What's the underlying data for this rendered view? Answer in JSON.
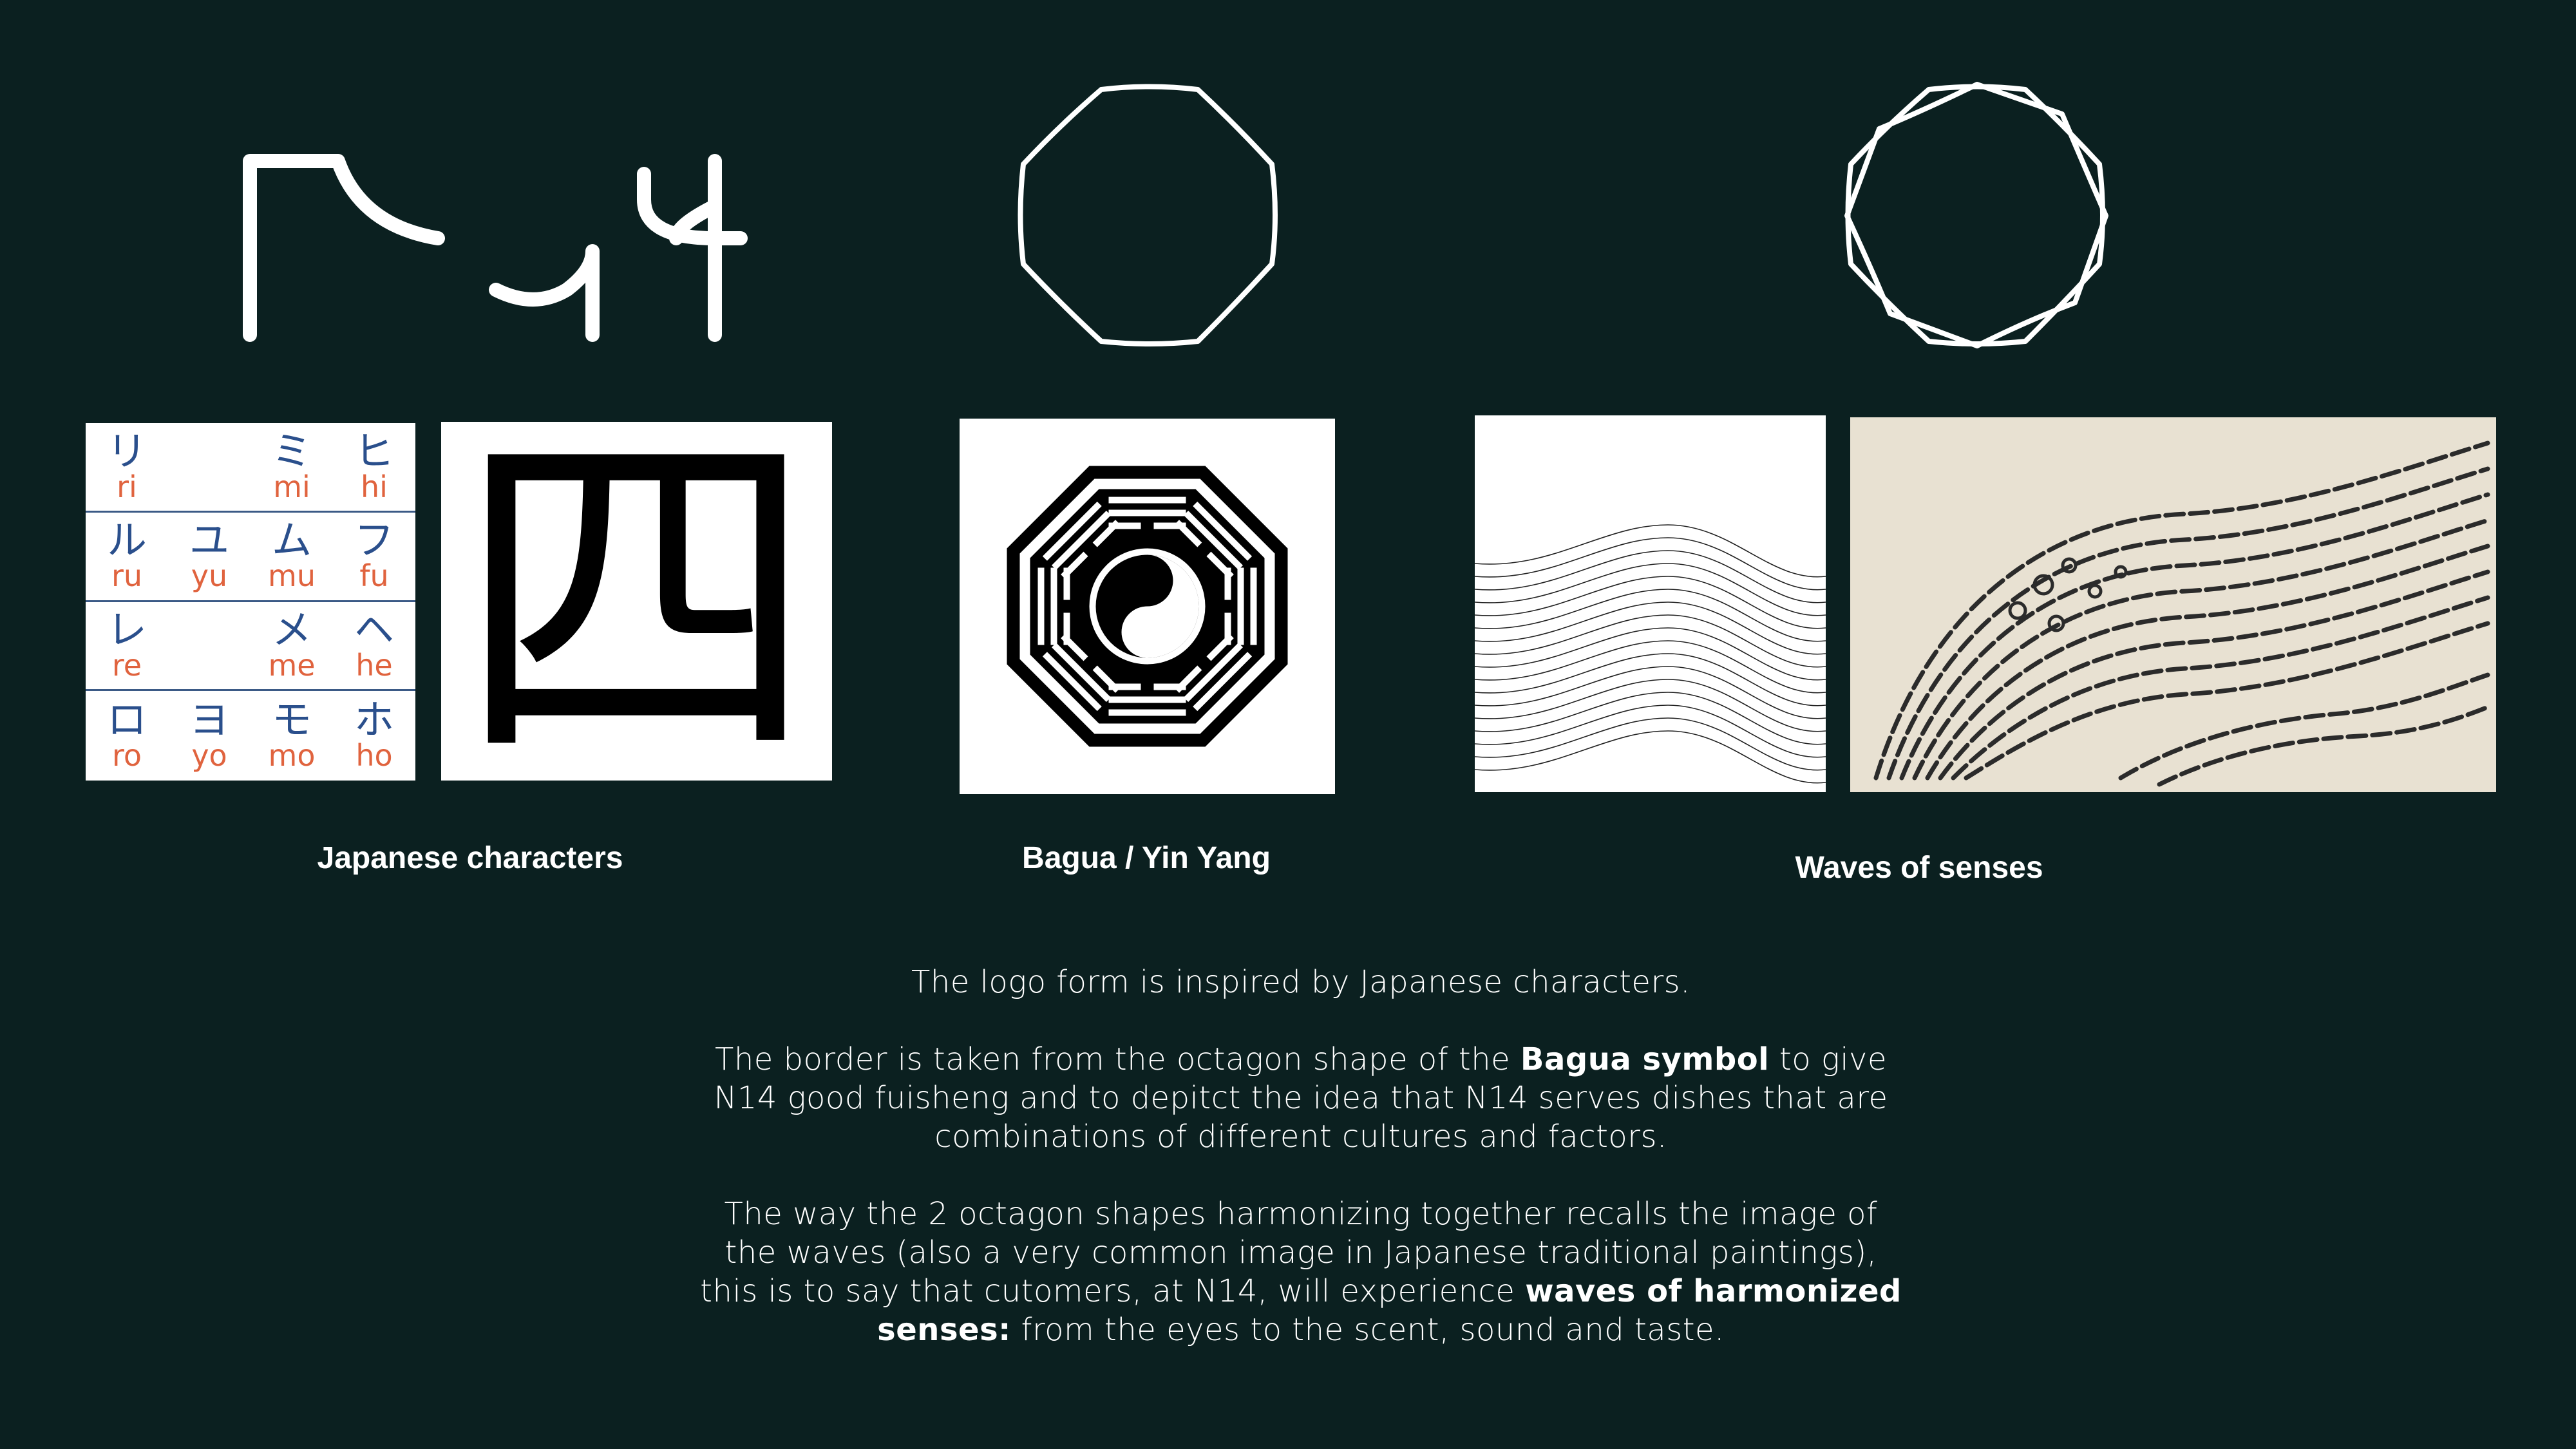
{
  "colors": {
    "background": "#0b2020",
    "kana_char": "#2a4f8c",
    "kana_romaji": "#e0633e"
  },
  "kana_chart": [
    {
      "kana": "リ",
      "romaji": "ri"
    },
    {
      "kana": "",
      "romaji": ""
    },
    {
      "kana": "ミ",
      "romaji": "mi"
    },
    {
      "kana": "ヒ",
      "romaji": "hi"
    },
    {
      "kana": "ル",
      "romaji": "ru"
    },
    {
      "kana": "ユ",
      "romaji": "yu"
    },
    {
      "kana": "ム",
      "romaji": "mu"
    },
    {
      "kana": "フ",
      "romaji": "fu"
    },
    {
      "kana": "レ",
      "romaji": "re"
    },
    {
      "kana": "",
      "romaji": ""
    },
    {
      "kana": "メ",
      "romaji": "me"
    },
    {
      "kana": "ヘ",
      "romaji": "he"
    },
    {
      "kana": "ロ",
      "romaji": "ro"
    },
    {
      "kana": "ヨ",
      "romaji": "yo"
    },
    {
      "kana": "モ",
      "romaji": "mo"
    },
    {
      "kana": "ホ",
      "romaji": "ho"
    }
  ],
  "kanji": "四",
  "captions": {
    "japanese": "Japanese characters",
    "bagua": "Bagua / Yin Yang",
    "waves": "Waves of senses"
  },
  "body": {
    "p1": "The logo form is inspired by Japanese characters.",
    "p2_pre": "The border is taken from the octagon shape of the ",
    "p2_bold": "Bagua symbol",
    "p2_post": " to give N14 good fuisheng and to depitct the idea that N14 serves dishes that are combinations of different cultures and factors.",
    "p3_pre": "The way the 2 octagon shapes harmonizing together recalls the image of the waves (also a very common image in Japanese traditional paintings), this is to say that cutomers, at N14, will experience ",
    "p3_bold": "waves of harmonized senses:",
    "p3_post": " from the eyes to the scent, sound and taste."
  }
}
